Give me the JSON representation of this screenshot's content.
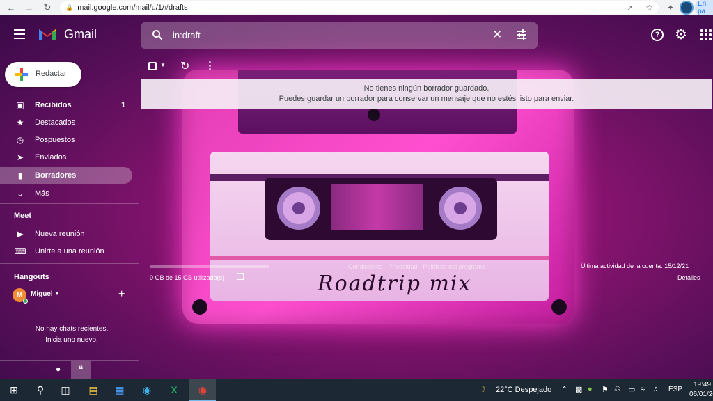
{
  "browser": {
    "url": "mail.google.com/mail/u/1/#drafts",
    "profile_label": "En pa"
  },
  "header": {
    "brand": "Gmail",
    "search_query": "in:draft"
  },
  "sidebar": {
    "compose_label": "Redactar",
    "items": [
      {
        "label": "Recibidos",
        "count": "1",
        "icon": "inbox-icon"
      },
      {
        "label": "Destacados",
        "icon": "star-icon"
      },
      {
        "label": "Pospuestos",
        "icon": "clock-icon"
      },
      {
        "label": "Enviados",
        "icon": "send-icon"
      },
      {
        "label": "Borradores",
        "icon": "draft-icon"
      },
      {
        "label": "Más",
        "icon": "chevron-down-icon"
      }
    ],
    "meet": {
      "title": "Meet",
      "items": [
        {
          "label": "Nueva reunión",
          "icon": "video-icon"
        },
        {
          "label": "Unirte a una reunión",
          "icon": "keyboard-icon"
        }
      ]
    },
    "hangouts": {
      "title": "Hangouts",
      "user_initial": "M",
      "user_name": "Miguel",
      "empty_line1": "No hay chats recientes.",
      "empty_line2": "Inicia uno nuevo."
    }
  },
  "main": {
    "empty_line1": "No tienes ningún borrador guardado.",
    "empty_line2": "Puedes guardar un borrador para conservar un mensaje que no estés listo para enviar.",
    "storage_text": "0 GB de 15 GB utilizado(s)",
    "storage_fraction": 0.0,
    "footer_center": "Condiciones · Privacidad · Políticas del programa",
    "last_activity": "Última actividad de la cuenta: 15/12/21",
    "details": "Detalles"
  },
  "theme": {
    "cassette_text": "Roadtrip mix"
  },
  "taskbar": {
    "weather": "22°C  Despejado",
    "language": "ESP",
    "time": "19:49",
    "date": "06/01/20"
  },
  "colors": {
    "theme_bg": "#5a0f5a",
    "accent_pink": "#ff3ccf",
    "taskbar": "#1c2833"
  }
}
